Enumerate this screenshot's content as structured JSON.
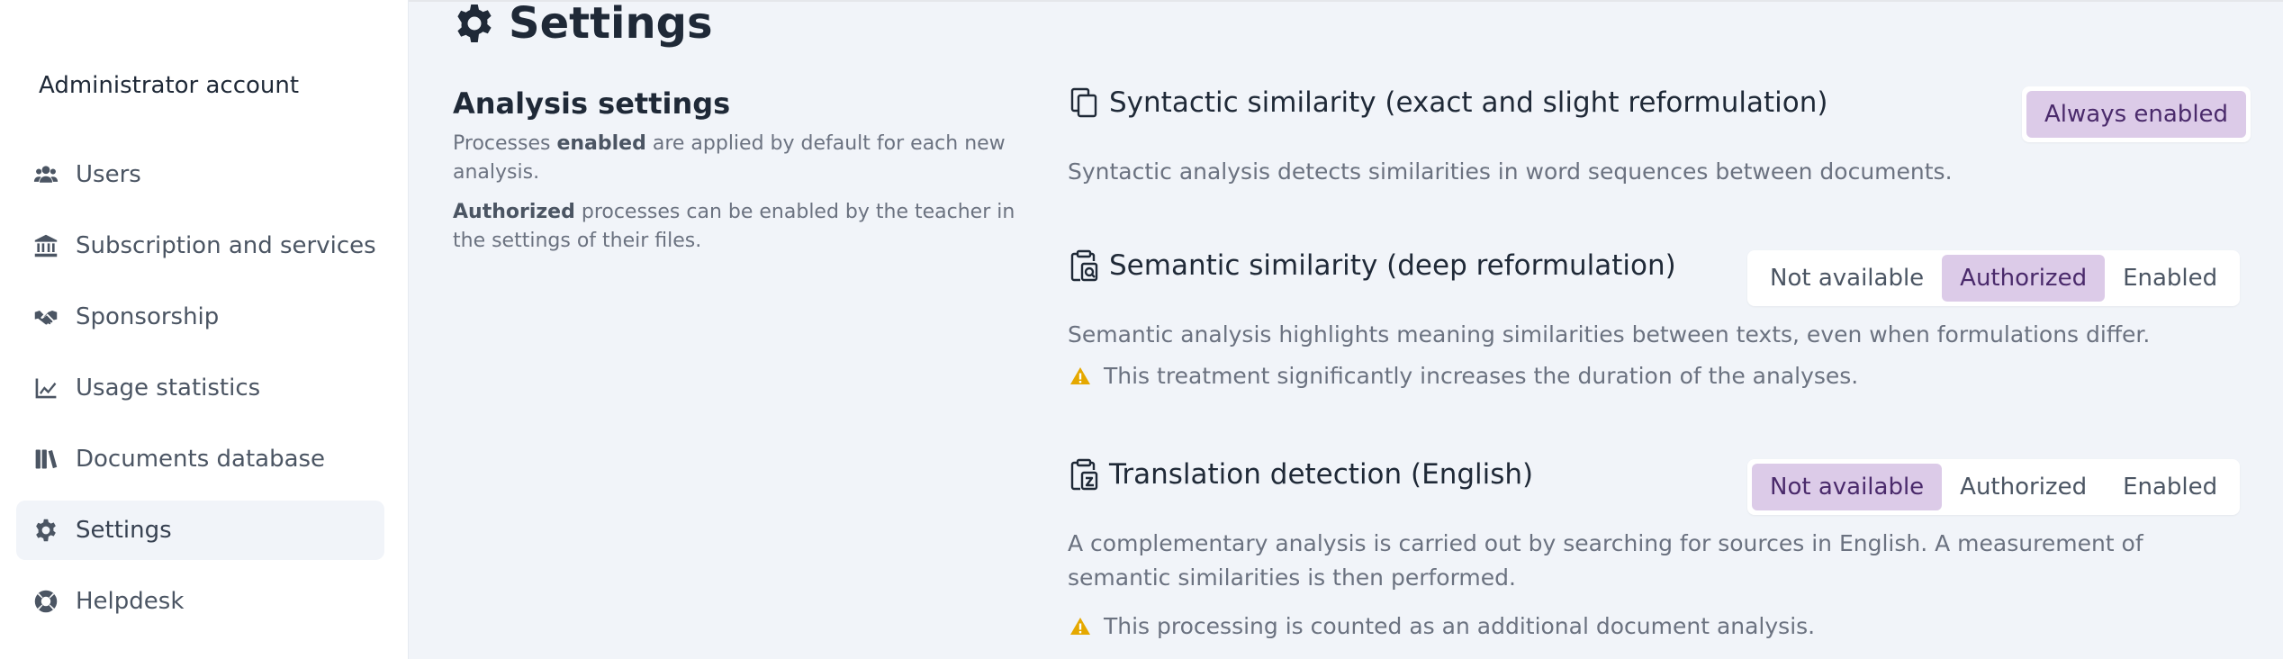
{
  "colors": {
    "background": "#f1f4f9",
    "sidebar": "#ffffff",
    "selected_badge": "#dccbe8",
    "selected_text": "#4a2a6b",
    "warning": "#e5a800"
  },
  "sidebar": {
    "account_label": "Administrator account",
    "items": [
      {
        "label": "Users",
        "icon": "users-icon"
      },
      {
        "label": "Subscription and services",
        "icon": "bank-icon"
      },
      {
        "label": "Sponsorship",
        "icon": "handshake-icon"
      },
      {
        "label": "Usage statistics",
        "icon": "chart-line-icon"
      },
      {
        "label": "Documents database",
        "icon": "books-icon"
      },
      {
        "label": "Settings",
        "icon": "gear-icon",
        "active": true
      },
      {
        "label": "Helpdesk",
        "icon": "lifebuoy-icon"
      }
    ]
  },
  "header": {
    "title": "Settings",
    "icon": "gear-icon"
  },
  "analysis": {
    "title": "Analysis settings",
    "desc1_prefix": "Processes ",
    "desc1_bold": "enabled",
    "desc1_suffix": " are applied by default for each new analysis.",
    "desc2_bold": "Authorized",
    "desc2_suffix": " processes can be enabled by the teacher in the settings of their files."
  },
  "features": {
    "syntactic": {
      "title": "Syntactic similarity (exact and slight reformulation)",
      "icon": "copy-icon",
      "badge": "Always enabled",
      "description": "Syntactic analysis detects similarities in word sequences between documents."
    },
    "semantic": {
      "title": "Semantic similarity (deep reformulation)",
      "icon": "clipboard-semantic-icon",
      "options": [
        "Not available",
        "Authorized",
        "Enabled"
      ],
      "selected": "Authorized",
      "description": "Semantic analysis highlights meaning similarities between texts, even when formulations differ.",
      "warning": "This treatment significantly increases the duration of the analyses."
    },
    "translation": {
      "title": "Translation detection (English)",
      "icon": "clipboard-translate-icon",
      "options": [
        "Not available",
        "Authorized",
        "Enabled"
      ],
      "selected": "Not available",
      "description": "A complementary analysis is carried out by searching for sources in English. A measurement of semantic similarities is then performed.",
      "warning": "This processing is counted as an additional document analysis."
    }
  }
}
